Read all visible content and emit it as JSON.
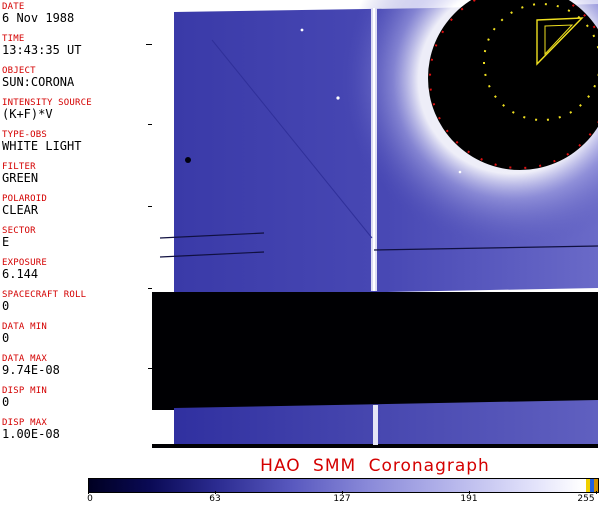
{
  "header_fields": [
    {
      "label": "DATE",
      "value": "6 Nov 1988"
    },
    {
      "label": "TIME",
      "value": "13:43:35 UT"
    },
    {
      "label": "OBJECT",
      "value": "SUN:CORONA"
    },
    {
      "label": "INTENSITY SOURCE",
      "value": "(K+F)*V"
    },
    {
      "label": "TYPE-OBS",
      "value": "WHITE LIGHT"
    },
    {
      "label": "FILTER",
      "value": "GREEN"
    },
    {
      "label": "POLAROID",
      "value": "CLEAR"
    },
    {
      "label": "SECTOR",
      "value": "E"
    },
    {
      "label": "EXPOSURE",
      "value": "6.144"
    },
    {
      "label": "SPACECRAFT ROLL",
      "value": "0"
    },
    {
      "label": "DATA MIN",
      "value": "0"
    },
    {
      "label": "DATA MAX",
      "value": "9.74E-08"
    },
    {
      "label": "DISP MIN",
      "value": "0"
    },
    {
      "label": "DISP MAX",
      "value": "1.00E-08"
    }
  ],
  "footer": {
    "title": "HAO  SMM  Coronagraph"
  },
  "colorbar": {
    "ticks": [
      "0",
      "63",
      "127",
      "191",
      "255"
    ],
    "colors": {
      "low": "#000022",
      "high": "#ffffff"
    }
  },
  "colors": {
    "label_red": "#d40000",
    "image_blue": "#4a4ab8",
    "occulter_dots_red": "#e01010",
    "occulter_dots_yellow": "#f0e020"
  }
}
